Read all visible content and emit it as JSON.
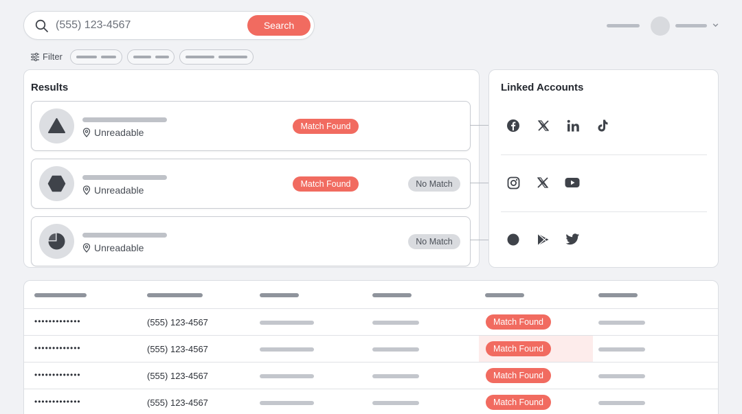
{
  "search": {
    "value": "(555) 123-4567",
    "button_label": "Search",
    "icon": "search-icon"
  },
  "filter": {
    "label": "Filter",
    "icon": "sliders-icon"
  },
  "results": {
    "title": "Results",
    "items": [
      {
        "avatar_icon": "triangle-icon",
        "location": "Unreadable",
        "badges": [
          "Match Found"
        ]
      },
      {
        "avatar_icon": "hexagon-icon",
        "location": "Unreadable",
        "badges": [
          "Match Found",
          "No Match"
        ]
      },
      {
        "avatar_icon": "pie-icon",
        "location": "Unreadable",
        "badges": [
          "No Match"
        ]
      }
    ]
  },
  "linked": {
    "title": "Linked Accounts",
    "rows": [
      [
        "facebook-icon",
        "x-icon",
        "linkedin-icon",
        "tiktok-icon"
      ],
      [
        "instagram-icon",
        "x-icon",
        "youtube-icon"
      ],
      [
        "circle-icon",
        "google-play-icon",
        "twitter-icon"
      ]
    ]
  },
  "table": {
    "rows": [
      {
        "masked": "•••••••••••••",
        "phone": "(555) 123-4567",
        "status": "Match Found"
      },
      {
        "masked": "•••••••••••••",
        "phone": "(555) 123-4567",
        "status": "Match Found"
      },
      {
        "masked": "•••••••••••••",
        "phone": "(555) 123-4567",
        "status": "Match Found"
      },
      {
        "masked": "•••••••••••••",
        "phone": "(555) 123-4567",
        "status": "Match Found"
      }
    ]
  },
  "colors": {
    "accent": "#f16b60",
    "muted_badge": "#d9dbdf",
    "icon": "#3f434a"
  }
}
